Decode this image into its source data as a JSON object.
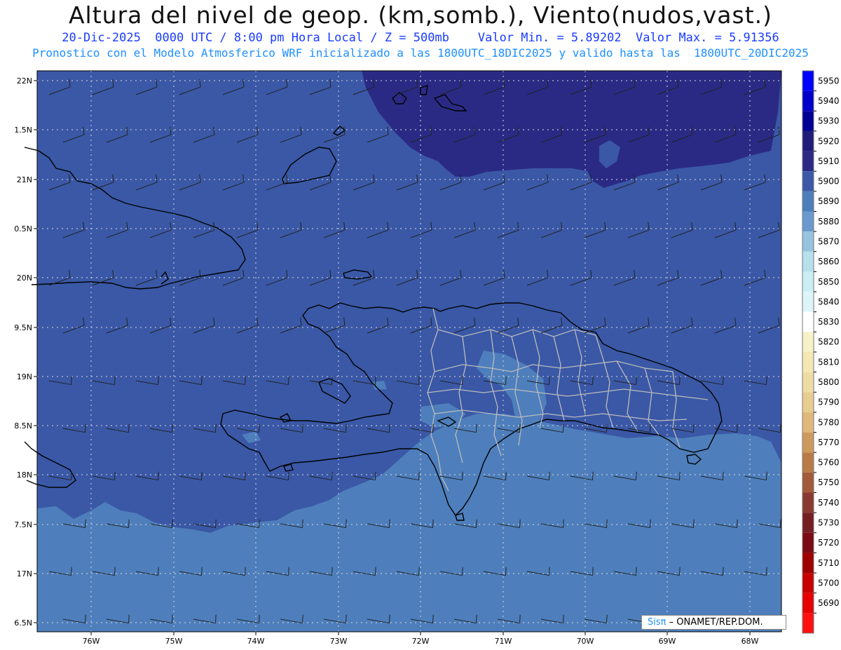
{
  "header": {
    "title": "Altura del nivel de geop. (km,somb.), Viento(nudos,vast.)",
    "line1": "20-Dic-2025  0000 UTC / 8:00 pm Hora Local / Z = 500mb    Valor Min. = 5.89202  Valor Max. = 5.91356",
    "line2": "Pronostico con el Modelo Atmosferico WRF inicializado a las 1800UTC_18DIC2025 y valido hasta las  1800UTC_20DIC2025"
  },
  "map": {
    "lat_labels": [
      "22N",
      "1.5N",
      "21N",
      "0.5N",
      "20N",
      "9.5N",
      "19N",
      "8.5N",
      "18N",
      "7.5N",
      "17N",
      "6.5N"
    ],
    "lon_labels": [
      "76W",
      "75W",
      "74W",
      "73W",
      "72W",
      "71W",
      "70W",
      "69W",
      "68W"
    ],
    "colors": {
      "c5920": "#2a2a85",
      "c5910": "#3a58a6",
      "c5900": "#4e7fbc",
      "c5890": "#5f96c8"
    }
  },
  "colorbar": {
    "levels": [
      "5950",
      "5940",
      "5930",
      "5920",
      "5910",
      "5900",
      "5890",
      "5880",
      "5870",
      "5860",
      "5850",
      "5840",
      "5830",
      "5820",
      "5810",
      "5800",
      "5790",
      "5780",
      "5770",
      "5760",
      "5750",
      "5740",
      "5730",
      "5720",
      "5710",
      "5700",
      "5690"
    ],
    "colors": [
      "#0000ff",
      "#0000cd",
      "#000096",
      "#1e1e7a",
      "#2a2a85",
      "#3a58a6",
      "#4e7fbc",
      "#6a9acd",
      "#96c3e0",
      "#b5e0ec",
      "#cbeef5",
      "#ddf5fa",
      "#ffffff",
      "#f8f0c8",
      "#f5e6b4",
      "#efdca5",
      "#e8cc90",
      "#dfb87a",
      "#cd9a5e",
      "#b97c48",
      "#a25a3a",
      "#8a3a30",
      "#741e24",
      "#7a0a14",
      "#9e0000",
      "#c80000",
      "#e80000",
      "#ff1010"
    ]
  },
  "credit": {
    "logo": "Sisπ",
    "text": "– ONAMET/REP.DOM."
  }
}
